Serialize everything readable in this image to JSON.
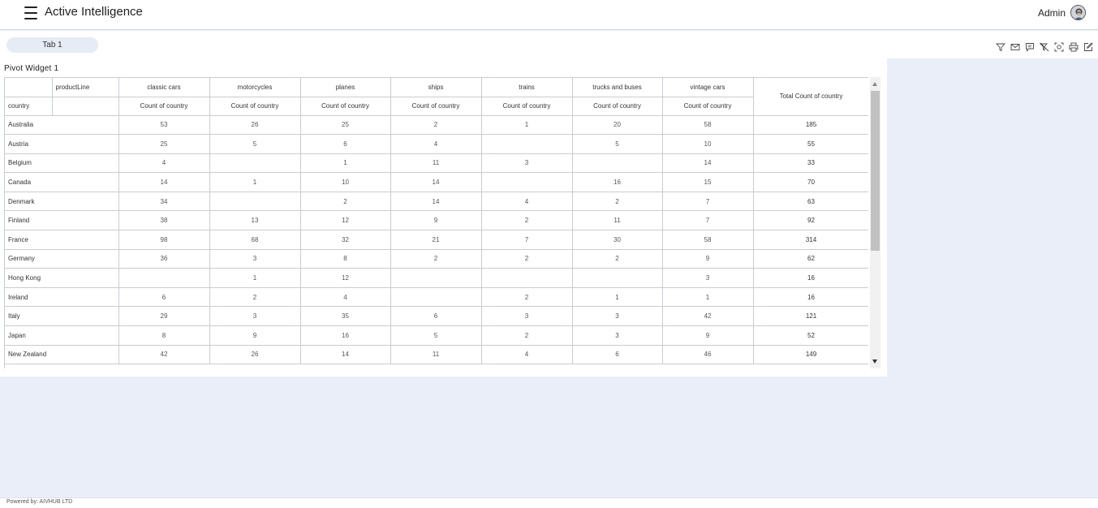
{
  "header": {
    "app_title": "Active Intelligence",
    "user_name": "Admin"
  },
  "tabs": [
    {
      "label": "Tab 1"
    }
  ],
  "toolbar": [
    {
      "icon": "filter-icon"
    },
    {
      "icon": "mail-icon"
    },
    {
      "icon": "comment-icon"
    },
    {
      "icon": "clear-filter-icon"
    },
    {
      "icon": "screenshot-icon"
    },
    {
      "icon": "print-icon"
    },
    {
      "icon": "edit-icon"
    }
  ],
  "widget": {
    "title": "Pivot Widget 1",
    "corner_label": "productLine",
    "row_dimension": "country",
    "measure_label": "Count of country",
    "total_label": "Total Count of country",
    "columns": [
      "classic cars",
      "motorcycles",
      "planes",
      "ships",
      "trains",
      "trucks and buses",
      "vintage cars"
    ],
    "rows": [
      {
        "country": "Australia",
        "values": [
          "53",
          "26",
          "25",
          "2",
          "1",
          "20",
          "58"
        ],
        "total": "185"
      },
      {
        "country": "Austria",
        "values": [
          "25",
          "5",
          "6",
          "4",
          "",
          "5",
          "10"
        ],
        "total": "55"
      },
      {
        "country": "Belgium",
        "values": [
          "4",
          "",
          "1",
          "11",
          "3",
          "",
          "14"
        ],
        "total": "33"
      },
      {
        "country": "Canada",
        "values": [
          "14",
          "1",
          "10",
          "14",
          "",
          "16",
          "15"
        ],
        "total": "70"
      },
      {
        "country": "Denmark",
        "values": [
          "34",
          "",
          "2",
          "14",
          "4",
          "2",
          "7"
        ],
        "total": "63"
      },
      {
        "country": "Finland",
        "values": [
          "38",
          "13",
          "12",
          "9",
          "2",
          "11",
          "7"
        ],
        "total": "92"
      },
      {
        "country": "France",
        "values": [
          "98",
          "68",
          "32",
          "21",
          "7",
          "30",
          "58"
        ],
        "total": "314"
      },
      {
        "country": "Germany",
        "values": [
          "36",
          "3",
          "8",
          "2",
          "2",
          "2",
          "9"
        ],
        "total": "62"
      },
      {
        "country": "Hong Kong",
        "values": [
          "",
          "1",
          "12",
          "",
          "",
          "",
          "3"
        ],
        "total": "16"
      },
      {
        "country": "Ireland",
        "values": [
          "6",
          "2",
          "4",
          "",
          "2",
          "1",
          "1"
        ],
        "total": "16"
      },
      {
        "country": "Italy",
        "values": [
          "29",
          "3",
          "35",
          "6",
          "3",
          "3",
          "42"
        ],
        "total": "121"
      },
      {
        "country": "Japan",
        "values": [
          "8",
          "9",
          "16",
          "5",
          "2",
          "3",
          "9"
        ],
        "total": "52"
      },
      {
        "country": "New Zealand",
        "values": [
          "42",
          "26",
          "14",
          "11",
          "4",
          "6",
          "46"
        ],
        "total": "149"
      }
    ]
  },
  "footer": {
    "text": "Powered by: AIVHUB LTD"
  }
}
